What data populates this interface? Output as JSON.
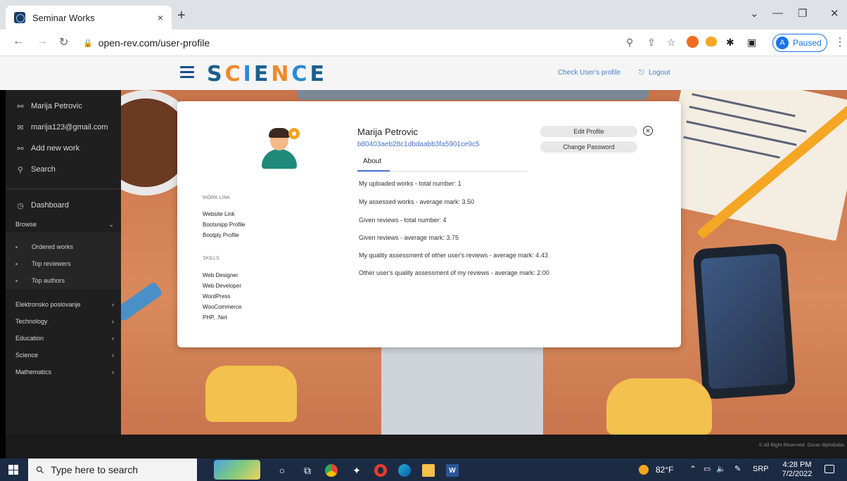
{
  "browser": {
    "tab_title": "Seminar Works",
    "tab_close": "×",
    "new_tab": "+",
    "url": "open-rev.com/user-profile",
    "profile_initial": "A",
    "profile_status": "Paused",
    "window_controls": [
      "⌄",
      "—",
      "❐",
      "✕"
    ]
  },
  "site_header": {
    "logo": "SCIENCE",
    "check_profile": "Check User's profile",
    "logout": "Logout",
    "logout_icon": "⎋"
  },
  "sidebar": {
    "top_items": [
      {
        "label": "Marija Petrovic",
        "icon": "link-icon"
      },
      {
        "label": "marija123@gmail.com",
        "icon": "mail-icon"
      },
      {
        "label": "Add new work",
        "icon": "link-icon"
      },
      {
        "label": "Search",
        "icon": "search-icon"
      }
    ],
    "dashboard": "Dashboard",
    "browse": "Browse",
    "browse_sub": [
      "Ordered works",
      "Top reviewers",
      "Top authors"
    ],
    "categories": [
      "Elektronsko poslovanje",
      "Technology",
      "Education",
      "Science",
      "Mathematics"
    ]
  },
  "profile": {
    "name": "Marija Petrovic",
    "id": "b80403aeb28c1dbdaabb3fa5901ce9c5",
    "tab_about": "About",
    "edit_profile": "Edit Profile",
    "change_password": "Change Password",
    "work_link_heading": "WORK LINK",
    "work_links": [
      "Website Link",
      "Bootsnipp Profile",
      "Bootply Profile"
    ],
    "skills_heading": "SKILLS",
    "skills": [
      "Web Designer",
      "Web Developer",
      "WordPress",
      "WooCommerce",
      "PHP, .Net"
    ],
    "stats": [
      "My uploaded works - total number: 1",
      "My assessed works - average mark: 3.50",
      "Given reviews - total number: 4",
      "Given reviews - average mark: 3.75",
      "My quality assessment of other user's reviews - average mark: 4.43",
      "Other user's quality assessment of my reviews - average mark: 2.00"
    ]
  },
  "footer": {
    "copyright": "© All Right Reserved. Goran Bjelobaba"
  },
  "taskbar": {
    "search_placeholder": "Type here to search",
    "temperature": "82°F",
    "language": "SRP",
    "time": "4:28 PM",
    "date": "7/2/2022"
  }
}
